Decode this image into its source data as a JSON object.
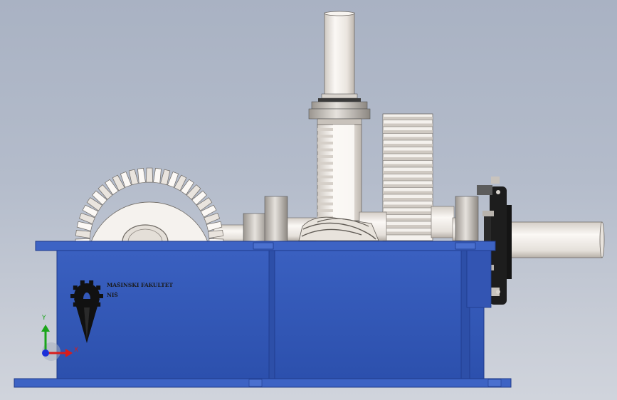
{
  "viewport": {
    "background_top": "#a9b2c3",
    "background_bottom": "#d0d4dc"
  },
  "model": {
    "housing_color": "#3358b8",
    "housing_edge_color": "#1f3a8a",
    "gear_color": "#ece8e2",
    "shaft_color": "#f2eeea",
    "flange_color": "#141414"
  },
  "logo": {
    "line1": "MAŠINSKI FAKULTET",
    "line2": "NIŠ"
  },
  "triad": {
    "x_label": "X",
    "y_label": "Y",
    "x_color": "#d81c1c",
    "y_color": "#1aa51a",
    "z_color": "#1c2fd8"
  }
}
